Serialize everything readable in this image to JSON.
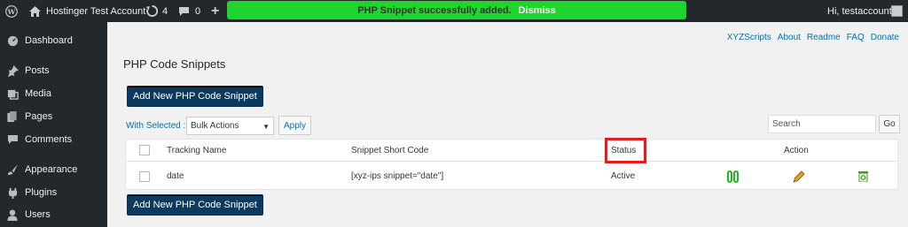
{
  "adminbar": {
    "site_name": "Hostinger Test Account",
    "updates_count": "4",
    "comments_count": "0",
    "notice_text": "PHP Snippet successfully added.",
    "notice_dismiss": "Dismiss",
    "greeting": "Hi, testaccount"
  },
  "sidebar": {
    "items": [
      {
        "label": "Dashboard",
        "icon": "dashboard-icon"
      },
      {
        "label": "Posts",
        "icon": "pushpin-icon"
      },
      {
        "label": "Media",
        "icon": "media-icon"
      },
      {
        "label": "Pages",
        "icon": "pages-icon"
      },
      {
        "label": "Comments",
        "icon": "comment-icon"
      },
      {
        "label": "Appearance",
        "icon": "paintbrush-icon"
      },
      {
        "label": "Plugins",
        "icon": "plug-icon"
      },
      {
        "label": "Users",
        "icon": "user-icon"
      }
    ]
  },
  "toplinks": [
    "XYZScripts",
    "About",
    "Readme",
    "FAQ",
    "Donate"
  ],
  "page": {
    "title": "PHP Code Snippets",
    "add_button": "Add New PHP Code Snippet",
    "with_selected": "With Selected :",
    "bulk_action": "Bulk Actions",
    "apply": "Apply",
    "search_placeholder": "Search",
    "go": "Go"
  },
  "table": {
    "headers": [
      "Tracking Name",
      "Snippet Short Code",
      "Status",
      "Action"
    ],
    "rows": [
      {
        "name": "date",
        "shortcode": "[xyz-ips snippet=\"date\"]",
        "status": "Active"
      }
    ]
  },
  "colors": {
    "notice_bg": "#1ed52d",
    "primary_button": "#0c3a5e",
    "link": "#0073aa",
    "highlight": "#e02020",
    "pause_icon": "#22b422"
  }
}
